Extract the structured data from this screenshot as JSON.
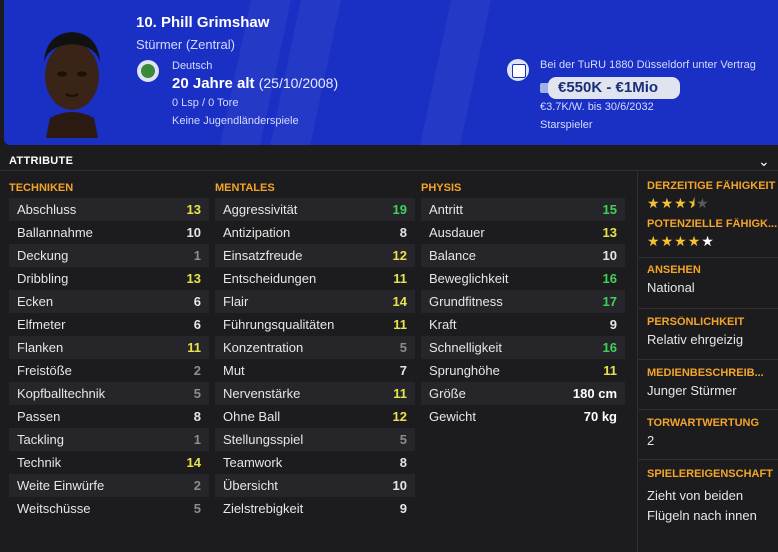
{
  "header": {
    "name": "10. Phill Grimshaw",
    "position": "Stürmer (Zentral)",
    "nationality": "Deutsch",
    "age": "20 Jahre alt",
    "dob": "(25/10/2008)",
    "apps": "0 Lsp / 0 Tore",
    "youth": "Keine Jugendländerspiele",
    "contract": "Bei der TuRU 1880 Düsseldorf unter Vertrag",
    "value": "€550K - €1Mio",
    "wage": "€3.7K/W. bis 30/6/2032",
    "status": "Starspieler"
  },
  "attributes": {
    "title": "ATTRIBUTE",
    "techniken": {
      "heading": "TECHNIKEN",
      "rows": [
        {
          "label": "Abschluss",
          "value": "13"
        },
        {
          "label": "Ballannahme",
          "value": "10"
        },
        {
          "label": "Deckung",
          "value": "1"
        },
        {
          "label": "Dribbling",
          "value": "13"
        },
        {
          "label": "Ecken",
          "value": "6"
        },
        {
          "label": "Elfmeter",
          "value": "6"
        },
        {
          "label": "Flanken",
          "value": "11"
        },
        {
          "label": "Freistöße",
          "value": "2"
        },
        {
          "label": "Kopfballtechnik",
          "value": "5"
        },
        {
          "label": "Passen",
          "value": "8"
        },
        {
          "label": "Tackling",
          "value": "1"
        },
        {
          "label": "Technik",
          "value": "14"
        },
        {
          "label": "Weite Einwürfe",
          "value": "2"
        },
        {
          "label": "Weitschüsse",
          "value": "5"
        }
      ]
    },
    "mentales": {
      "heading": "MENTALES",
      "rows": [
        {
          "label": "Aggressivität",
          "value": "19"
        },
        {
          "label": "Antizipation",
          "value": "8"
        },
        {
          "label": "Einsatzfreude",
          "value": "12"
        },
        {
          "label": "Entscheidungen",
          "value": "11"
        },
        {
          "label": "Flair",
          "value": "14"
        },
        {
          "label": "Führungsqualitäten",
          "value": "11"
        },
        {
          "label": "Konzentration",
          "value": "5"
        },
        {
          "label": "Mut",
          "value": "7"
        },
        {
          "label": "Nervenstärke",
          "value": "11"
        },
        {
          "label": "Ohne Ball",
          "value": "12"
        },
        {
          "label": "Stellungsspiel",
          "value": "5"
        },
        {
          "label": "Teamwork",
          "value": "8"
        },
        {
          "label": "Übersicht",
          "value": "10"
        },
        {
          "label": "Zielstrebigkeit",
          "value": "9"
        }
      ]
    },
    "physis": {
      "heading": "PHYSIS",
      "rows": [
        {
          "label": "Antritt",
          "value": "15"
        },
        {
          "label": "Ausdauer",
          "value": "13"
        },
        {
          "label": "Balance",
          "value": "10"
        },
        {
          "label": "Beweglichkeit",
          "value": "16"
        },
        {
          "label": "Grundfitness",
          "value": "17"
        },
        {
          "label": "Kraft",
          "value": "9"
        },
        {
          "label": "Schnelligkeit",
          "value": "16"
        },
        {
          "label": "Sprunghöhe",
          "value": "11"
        },
        {
          "label": "Größe",
          "value": "180 cm"
        },
        {
          "label": "Gewicht",
          "value": "70 kg"
        }
      ]
    }
  },
  "side": {
    "current_ability": {
      "heading": "DERZEITIGE FÄHIGKEIT",
      "stars": 3.5
    },
    "potential_ability": {
      "heading": "POTENZIELLE FÄHIGK...",
      "stars": 5
    },
    "reputation": {
      "heading": "ANSEHEN",
      "text": "National"
    },
    "personality": {
      "heading": "PERSÖNLICHKEIT",
      "text": "Relativ ehrgeizig"
    },
    "media": {
      "heading": "MEDIENBESCHREIB...",
      "text": "Junger Stürmer"
    },
    "gk_rating": {
      "heading": "TORWARTWERTUNG",
      "text": "2"
    },
    "traits": {
      "heading": "SPIELEREIGENSCHAFT",
      "line1": "Zieht von beiden",
      "line2": "Flügeln nach innen"
    }
  },
  "colors": {
    "header_bg": "#1a2fc4",
    "accent_orange": "#f3a52a",
    "value_green": "#3fd15b",
    "value_yellow": "#e8e34a",
    "value_grey": "#8c8c8c"
  }
}
